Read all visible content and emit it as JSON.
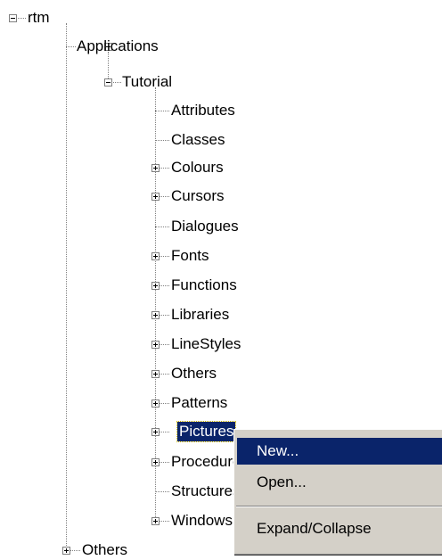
{
  "tree": {
    "root": "rtm",
    "applications": "Applications",
    "tutorial": "Tutorial",
    "items": [
      "Attributes",
      "Classes",
      "Colours",
      "Cursors",
      "Dialogues",
      "Fonts",
      "Functions",
      "Libraries",
      "LineStyles",
      "Others",
      "Patterns",
      "Pictures",
      "Procedures",
      "Structures",
      "Windows"
    ],
    "others_bottom": "Others"
  },
  "context_menu": {
    "new": "New...",
    "open": "Open...",
    "expand_collapse": "Expand/Collapse"
  },
  "colors": {
    "selection": "#0a246a",
    "menu_bg": "#d4d0c8"
  }
}
